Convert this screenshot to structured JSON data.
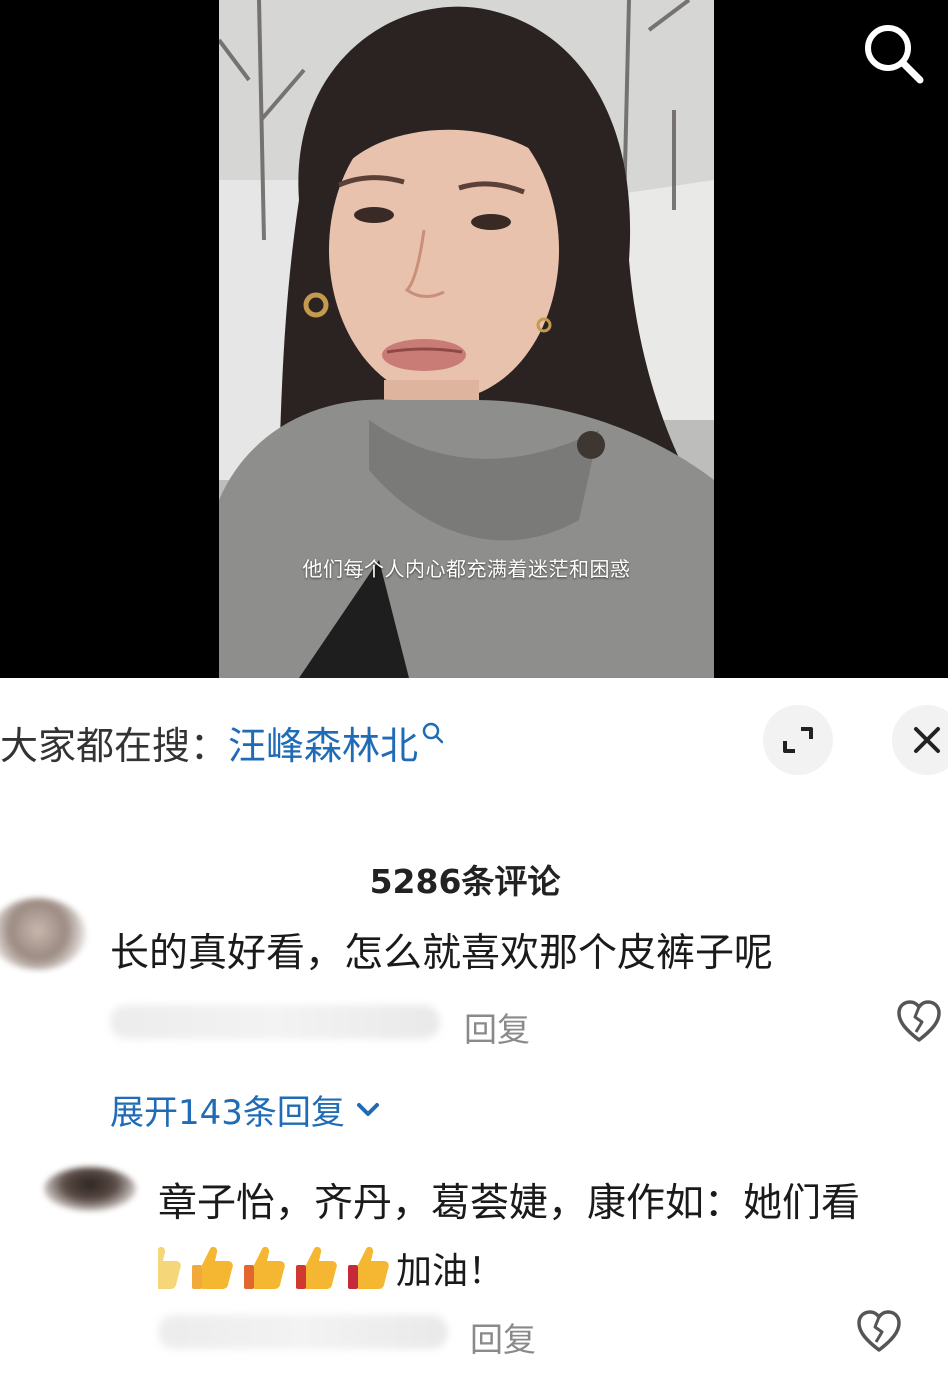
{
  "video": {
    "subtitle": "他们每个人内心都充满着迷茫和困惑"
  },
  "hot_search": {
    "prefix": "大家都在搜：",
    "term": "汪峰森林北"
  },
  "comments": {
    "count_label": "5286条评论",
    "items": [
      {
        "text": "长的真好看，怎么就喜欢那个皮裤子呢",
        "reply_label": "回复",
        "expand_label": "展开143条回复"
      },
      {
        "text": "章子怡，齐丹，葛荟婕，康作如：她们看",
        "text_tail": "加油！",
        "reply_label": "回复",
        "emoji_count": 5
      }
    ]
  },
  "icons": {
    "search": "search-icon",
    "expand": "expand-icon",
    "close": "close-icon",
    "dislike": "broken-heart-icon",
    "thumb": "thumbs-up-emoji",
    "chevron": "chevron-down-icon"
  },
  "colors": {
    "link_blue": "#1f6bb5",
    "muted_gray": "#8a8a8a",
    "thumb_yellow": "#f5b731"
  }
}
